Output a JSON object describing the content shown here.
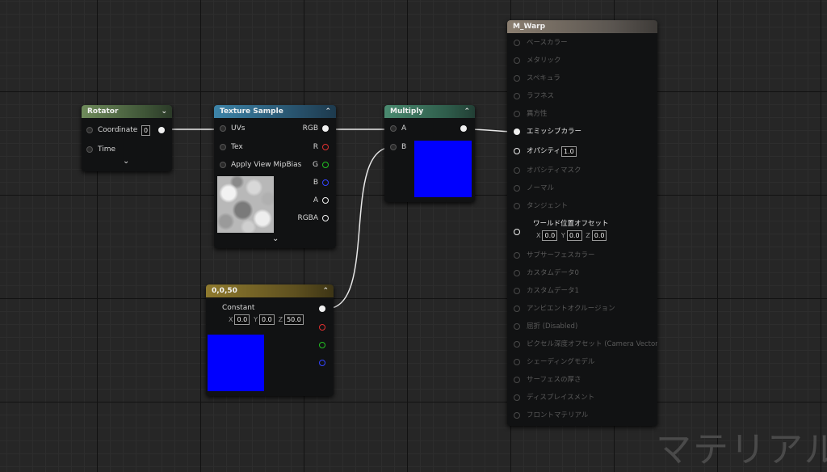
{
  "rotator": {
    "title": "Rotator",
    "coordinate_label": "Coordinate",
    "coordinate_value": "0",
    "time_label": "Time"
  },
  "texture_sample": {
    "title": "Texture Sample",
    "inputs": [
      "UVs",
      "Tex",
      "Apply View MipBias"
    ],
    "outputs": [
      "RGB",
      "R",
      "G",
      "B",
      "A",
      "RGBA"
    ]
  },
  "multiply": {
    "title": "Multiply",
    "input_a": "A",
    "input_b": "B",
    "preview_color": "#0000ff"
  },
  "constant": {
    "title": "0,0,50",
    "label": "Constant",
    "x_label": "X",
    "x_value": "0.0",
    "y_label": "Y",
    "y_value": "0.0",
    "z_label": "Z",
    "z_value": "50.0",
    "preview_color": "#0000ff"
  },
  "material": {
    "title": "M_Warp",
    "rows": [
      "ベースカラー",
      "メタリック",
      "スペキュラ",
      "ラフネス",
      "異方性",
      "エミッシブカラー",
      "オパシティ",
      "オパシティマスク",
      "ノーマル",
      "タンジェント",
      "ワールド位置オフセット",
      "サブサーフェスカラー",
      "カスタムデータ0",
      "カスタムデータ1",
      "アンビエントオクルージョン",
      "屈折 (Disabled)",
      "ピクセル深度オフセット (Camera Vector)",
      "シェーディングモデル",
      "サーフェスの厚さ",
      "ディスプレイスメント",
      "フロントマテリアル"
    ],
    "opacity_value": "1.0",
    "wpo": {
      "x_label": "X",
      "x": "0.0",
      "y_label": "Y",
      "y": "0.0",
      "z_label": "Z",
      "z": "0.0"
    }
  },
  "watermark": "マテリアル"
}
